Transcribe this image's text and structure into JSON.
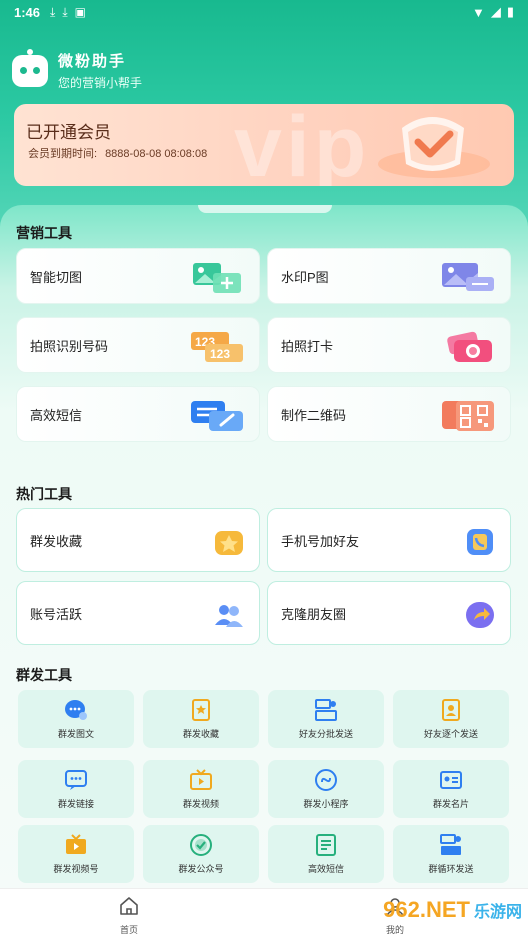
{
  "status": {
    "time": "1:46"
  },
  "brand": {
    "name": "微粉助手",
    "slogan": "您的营销小帮手"
  },
  "vip": {
    "title": "已开通会员",
    "expire_label": "会员到期时间:",
    "expire_value": "8888-08-08 08:08:08"
  },
  "marketing": {
    "title": "营销工具",
    "items": [
      {
        "label": "智能切图",
        "icon": "image-split-icon"
      },
      {
        "label": "水印P图",
        "icon": "watermark-image-icon"
      },
      {
        "label": "拍照识别号码",
        "icon": "number-recognition-icon"
      },
      {
        "label": "拍照打卡",
        "icon": "camera-checkin-icon"
      },
      {
        "label": "高效短信",
        "icon": "sms-icon"
      },
      {
        "label": "制作二维码",
        "icon": "qrcode-icon"
      }
    ]
  },
  "hot": {
    "title": "热门工具",
    "items": [
      {
        "label": "群发收藏",
        "icon": "star-favorite-icon",
        "color": "#f6b93b"
      },
      {
        "label": "手机号加好友",
        "icon": "phone-contact-icon",
        "color": "#4f8ef7"
      },
      {
        "label": "账号活跃",
        "icon": "users-icon",
        "color": "#5a8ef5"
      },
      {
        "label": "克隆朋友圈",
        "icon": "share-arrow-icon",
        "color": "#7b6ff0"
      }
    ]
  },
  "mass": {
    "title": "群发工具",
    "items": [
      {
        "label": "群发图文",
        "icon": "chat-bubble-icon"
      },
      {
        "label": "群发收藏",
        "icon": "favorite-tag-icon"
      },
      {
        "label": "好友分批发送",
        "icon": "batch-send-icon"
      },
      {
        "label": "好友逐个发送",
        "icon": "person-card-icon"
      },
      {
        "label": "群发链接",
        "icon": "link-message-icon"
      },
      {
        "label": "群发视频",
        "icon": "tv-video-icon"
      },
      {
        "label": "群发小程序",
        "icon": "mini-program-icon"
      },
      {
        "label": "群发名片",
        "icon": "business-card-icon"
      },
      {
        "label": "群发视频号",
        "icon": "video-channel-icon"
      },
      {
        "label": "群发公众号",
        "icon": "official-account-icon"
      },
      {
        "label": "高效短信",
        "icon": "sms-doc-icon"
      },
      {
        "label": "群循环发送",
        "icon": "loop-send-icon"
      }
    ]
  },
  "tabbar": {
    "home": "首页",
    "mine": "我的"
  },
  "watermark": {
    "brand": "962.NET",
    "sub": "乐游网"
  },
  "colors": {
    "primary": "#1cb98f",
    "accent": "#f26b4d",
    "vip_bg": "#ffd6c4"
  }
}
